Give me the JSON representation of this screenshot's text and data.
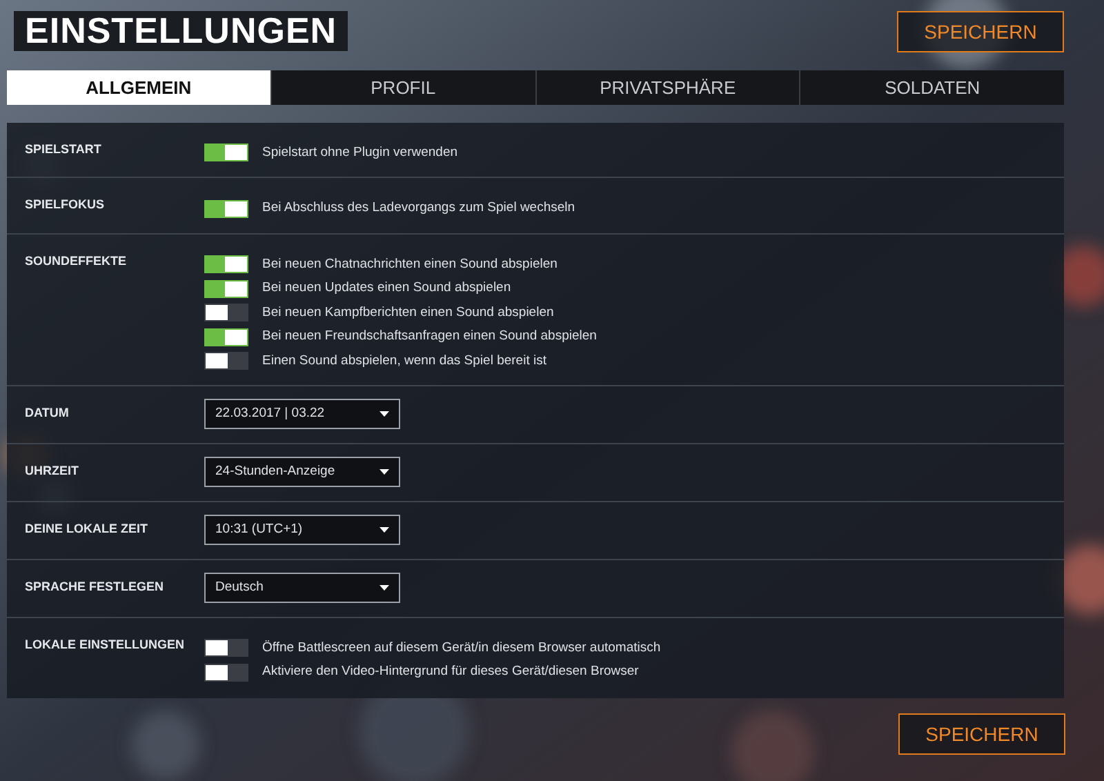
{
  "title": "EINSTELLUNGEN",
  "save_buttons": [
    "SPEICHERN",
    "SPEICHERN"
  ],
  "tabs": [
    {
      "label": "ALLGEMEIN",
      "selected": true
    },
    {
      "label": "PROFIL",
      "selected": false
    },
    {
      "label": "PRIVATSPHÄRE",
      "selected": false
    },
    {
      "label": "SOLDATEN",
      "selected": false
    }
  ],
  "sections": [
    {
      "label": "SPIELSTART",
      "kind": "toggles",
      "options": [
        {
          "text": "Spielstart ohne Plugin verwenden",
          "on": true
        }
      ]
    },
    {
      "label": "SPIELFOKUS",
      "kind": "toggles",
      "options": [
        {
          "text": "Bei Abschluss des Ladevorgangs zum Spiel wechseln",
          "on": true
        }
      ]
    },
    {
      "label": "SOUNDEFFEKTE",
      "kind": "toggles",
      "options": [
        {
          "text": "Bei neuen Chatnachrichten einen Sound abspielen",
          "on": true
        },
        {
          "text": "Bei neuen Updates einen Sound abspielen",
          "on": true
        },
        {
          "text": "Bei neuen Kampfberichten einen Sound abspielen",
          "on": false
        },
        {
          "text": "Bei neuen Freundschaftsanfragen einen Sound abspielen",
          "on": true
        },
        {
          "text": "Einen Sound abspielen, wenn das Spiel bereit ist",
          "on": false
        }
      ]
    },
    {
      "label": "DATUM",
      "kind": "select",
      "value": "22.03.2017 | 03.22"
    },
    {
      "label": "UHRZEIT",
      "kind": "select",
      "value": "24-Stunden-Anzeige"
    },
    {
      "label": "DEINE LOKALE ZEIT",
      "kind": "select",
      "value": "10:31 (UTC+1)"
    },
    {
      "label": "SPRACHE FESTLEGEN",
      "kind": "select",
      "value": "Deutsch"
    },
    {
      "label": "LOKALE EINSTELLUNGEN",
      "kind": "toggles",
      "options": [
        {
          "text": "Öffne Battlescreen auf diesem Gerät/in diesem Browser automatisch",
          "on": false
        },
        {
          "text": "Aktiviere den Video-Hintergrund für dieses Gerät/diesen Browser",
          "on": false
        }
      ]
    }
  ]
}
